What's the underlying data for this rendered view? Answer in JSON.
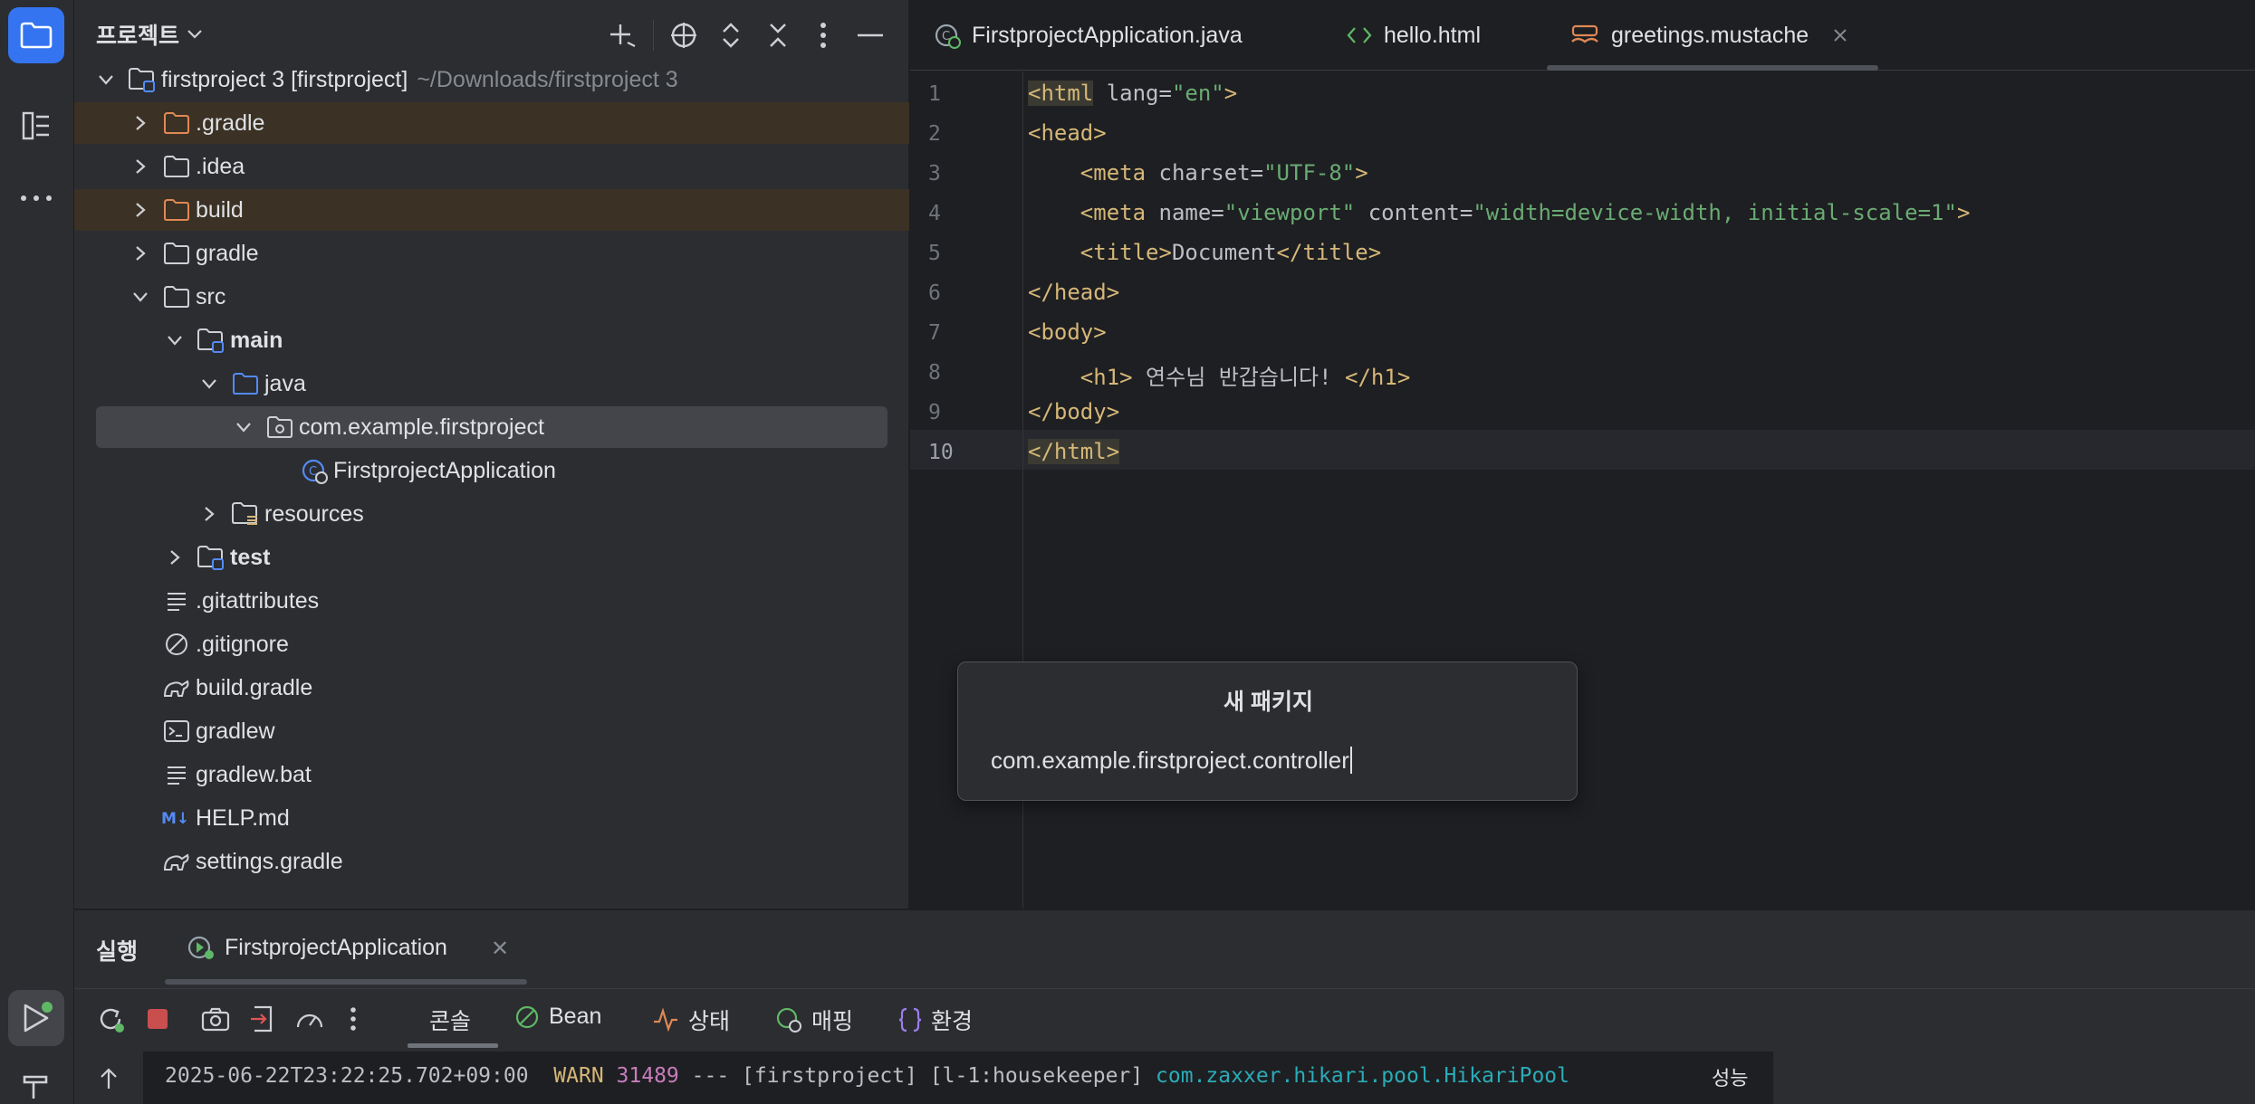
{
  "project": {
    "title": "프로젝트",
    "tree": [
      {
        "label": "firstproject 3 [firstproject]",
        "sub": "~/Downloads/firstproject 3",
        "icon": "module-folder-icon",
        "depth": 0,
        "chev": "down",
        "bold": false,
        "hl": ""
      },
      {
        "label": ".gradle",
        "icon": "folder-orange-icon",
        "depth": 1,
        "chev": "right",
        "hl": "orange"
      },
      {
        "label": ".idea",
        "icon": "folder-icon",
        "depth": 1,
        "chev": "right",
        "hl": ""
      },
      {
        "label": "build",
        "icon": "folder-orange-icon",
        "depth": 1,
        "chev": "right",
        "hl": "orange"
      },
      {
        "label": "gradle",
        "icon": "folder-icon",
        "depth": 1,
        "chev": "right",
        "hl": ""
      },
      {
        "label": "src",
        "icon": "folder-icon",
        "depth": 1,
        "chev": "down",
        "hl": ""
      },
      {
        "label": "main",
        "icon": "source-root-folder-icon",
        "depth": 2,
        "chev": "down",
        "bold": true,
        "hl": ""
      },
      {
        "label": "java",
        "icon": "folder-blue-icon",
        "depth": 3,
        "chev": "down",
        "hl": ""
      },
      {
        "label": "com.example.firstproject",
        "icon": "package-icon",
        "depth": 4,
        "chev": "down",
        "hl": "selected"
      },
      {
        "label": "FirstprojectApplication",
        "icon": "spring-class-icon",
        "depth": 5,
        "chev": "",
        "hl": ""
      },
      {
        "label": "resources",
        "icon": "resources-folder-icon",
        "depth": 3,
        "chev": "right",
        "hl": ""
      },
      {
        "label": "test",
        "icon": "test-folder-icon",
        "depth": 2,
        "chev": "right",
        "bold": true,
        "hl": ""
      },
      {
        "label": ".gitattributes",
        "icon": "text-file-icon",
        "depth": 1,
        "chev": "",
        "hl": ""
      },
      {
        "label": ".gitignore",
        "icon": "ignore-file-icon",
        "depth": 1,
        "chev": "",
        "hl": ""
      },
      {
        "label": "build.gradle",
        "icon": "gradle-file-icon",
        "depth": 1,
        "chev": "",
        "hl": ""
      },
      {
        "label": "gradlew",
        "icon": "shell-script-icon",
        "depth": 1,
        "chev": "",
        "hl": ""
      },
      {
        "label": "gradlew.bat",
        "icon": "text-file-icon",
        "depth": 1,
        "chev": "",
        "hl": ""
      },
      {
        "label": "HELP.md",
        "icon": "markdown-icon",
        "depth": 1,
        "chev": "",
        "hl": ""
      },
      {
        "label": "settings.gradle",
        "icon": "gradle-file-icon",
        "depth": 1,
        "chev": "",
        "hl": ""
      }
    ]
  },
  "editor": {
    "tabs": [
      {
        "label": "FirstprojectApplication.java",
        "icon": "spring-class-icon"
      },
      {
        "label": "hello.html",
        "icon": "html-icon"
      },
      {
        "label": "greetings.mustache",
        "icon": "mustache-icon",
        "active": true
      }
    ],
    "line_numbers": [
      "1",
      "2",
      "3",
      "4",
      "5",
      "6",
      "7",
      "8",
      "9",
      "10"
    ],
    "current_line": 10
  },
  "dialog": {
    "title": "새 패키지",
    "value": "com.example.firstproject.controller"
  },
  "run": {
    "title": "실행",
    "config_tab": "FirstprojectApplication",
    "tabs": [
      {
        "label": "콘솔",
        "icon": ""
      },
      {
        "label": "Bean",
        "icon": "bean-icon"
      },
      {
        "label": "상태",
        "icon": "health-icon"
      },
      {
        "label": "매핑",
        "icon": "mapping-icon"
      },
      {
        "label": "환경",
        "icon": "environment-icon"
      }
    ],
    "log": {
      "timestamp": "2025-06-22T23:22:25.702+09:00",
      "level": "WARN",
      "pid": "31489",
      "sep": "---",
      "app": "[firstproject]",
      "thread": "[l-1:housekeeper]",
      "logger": "com.zaxxer.hikari.pool.HikariPool"
    },
    "perf_label": "성능"
  },
  "colors": {
    "accent": "#3574f0",
    "tag": "#d5b778",
    "string": "#6aab73",
    "bg": "#1e1f22",
    "panel": "#2b2d30"
  }
}
